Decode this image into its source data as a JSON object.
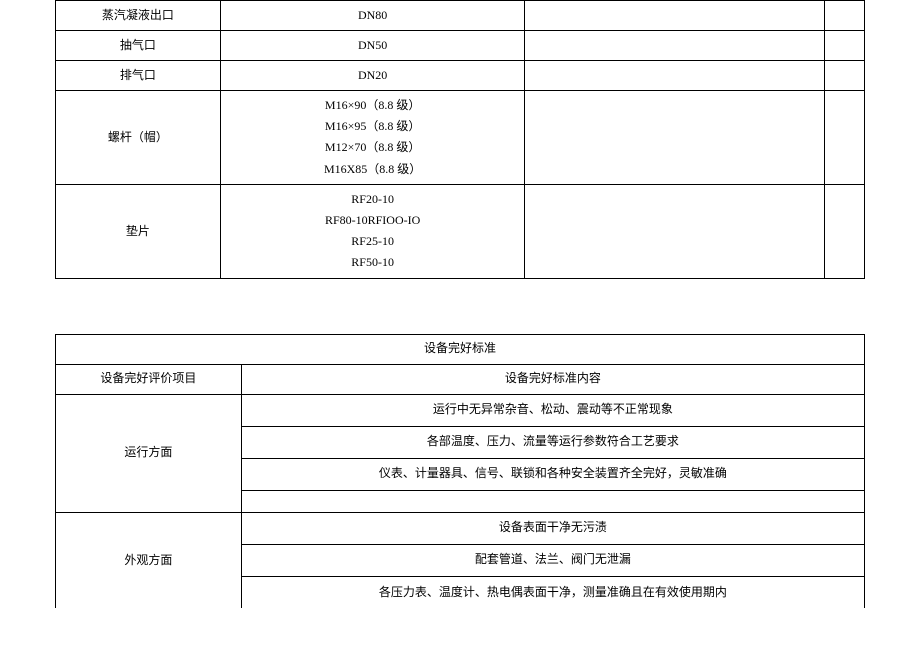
{
  "table1": {
    "rows": [
      {
        "label": "蒸汽凝液出口",
        "value": "DN80"
      },
      {
        "label": "抽气口",
        "value": "DN50"
      },
      {
        "label": "排气口",
        "value": "DN20"
      }
    ],
    "screwRow": {
      "label": "螺杆（帽）",
      "lines": [
        "M16×90（8.8 级）",
        "M16×95（8.8 级）",
        "M12×70（8.8 级）",
        "M16X85（8.8 级）"
      ]
    },
    "gasketRow": {
      "label": "垫片",
      "lines": [
        "RF20-10",
        "RF80-10RFIOO-IO",
        "RF25-10",
        "RF50-10"
      ]
    }
  },
  "table2": {
    "title": "设备完好标准",
    "header1": "设备完好评价项目",
    "header2": "设备完好标准内容",
    "section1": {
      "label": "运行方面",
      "items": [
        "运行中无异常杂音、松动、震动等不正常现象",
        "各部温度、压力、流量等运行参数符合工艺要求",
        "仪表、计量器具、信号、联锁和各种安全装置齐全完好，灵敏准确",
        ""
      ]
    },
    "section2": {
      "label": "外观方面",
      "items": [
        "设备表面干净无污渍",
        "配套管道、法兰、阀门无泄漏",
        "各压力表、温度计、热电偶表面干净，测量准确且在有效使用期内"
      ]
    }
  }
}
